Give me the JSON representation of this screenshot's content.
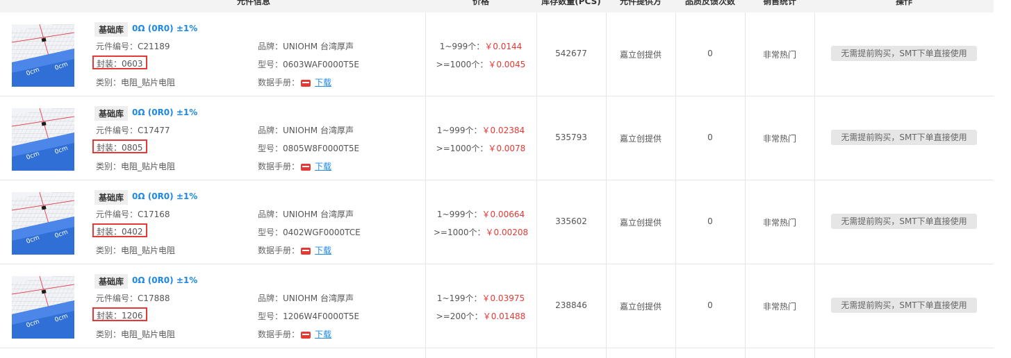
{
  "header": {
    "component_info": "元件信息",
    "price": "价格",
    "stock": "库存数量(PCS)",
    "provider": "元件提供方",
    "feedback": "品质反馈次数",
    "sales": "销售统计",
    "operation": "操作"
  },
  "rows": [
    {
      "tag": "基础库",
      "title": "0Ω (0R0) ±1%",
      "part_no_label": "元件编号：",
      "part_no": "C21189",
      "package_label": "封装：",
      "package": "0603",
      "category_label": "类别：",
      "category": "电阻_贴片电阻",
      "brand_label": "品牌：",
      "brand": "UNIOHM 台湾厚声",
      "model_label": "型号：",
      "model": "0603WAF0000T5E",
      "datasheet_label": "数据手册：",
      "download": "下载",
      "price_tiers": [
        {
          "qty": "1~999个：",
          "price": "￥0.0144"
        },
        {
          "qty": ">=1000个：",
          "price": "￥0.0045"
        }
      ],
      "stock": "542677",
      "provider": "嘉立创提供",
      "feedback": "0",
      "sales": "非常热门",
      "action": "无需提前购买，SMT下单直接使用"
    },
    {
      "tag": "基础库",
      "title": "0Ω (0R0) ±1%",
      "part_no_label": "元件编号：",
      "part_no": "C17477",
      "package_label": "封装：",
      "package": "0805",
      "category_label": "类别：",
      "category": "电阻_贴片电阻",
      "brand_label": "品牌：",
      "brand": "UNIOHM 台湾厚声",
      "model_label": "型号：",
      "model": "0805W8F0000T5E",
      "datasheet_label": "数据手册：",
      "download": "下载",
      "price_tiers": [
        {
          "qty": "1~999个：",
          "price": "￥0.02384"
        },
        {
          "qty": ">=1000个：",
          "price": "￥0.0078"
        }
      ],
      "stock": "535793",
      "provider": "嘉立创提供",
      "feedback": "0",
      "sales": "非常热门",
      "action": "无需提前购买，SMT下单直接使用"
    },
    {
      "tag": "基础库",
      "title": "0Ω (0R0) ±1%",
      "part_no_label": "元件编号：",
      "part_no": "C17168",
      "package_label": "封装：",
      "package": "0402",
      "category_label": "类别：",
      "category": "电阻_贴片电阻",
      "brand_label": "品牌：",
      "brand": "UNIOHM 台湾厚声",
      "model_label": "型号：",
      "model": "0402WGF0000TCE",
      "datasheet_label": "数据手册：",
      "download": "下载",
      "price_tiers": [
        {
          "qty": "1~999个：",
          "price": "￥0.00664"
        },
        {
          "qty": ">=1000个：",
          "price": "￥0.00208"
        }
      ],
      "stock": "335602",
      "provider": "嘉立创提供",
      "feedback": "0",
      "sales": "非常热门",
      "action": "无需提前购买，SMT下单直接使用"
    },
    {
      "tag": "基础库",
      "title": "0Ω (0R0) ±1%",
      "part_no_label": "元件编号：",
      "part_no": "C17888",
      "package_label": "封装：",
      "package": "1206",
      "category_label": "类别：",
      "category": "电阻_贴片电阻",
      "brand_label": "品牌：",
      "brand": "UNIOHM 台湾厚声",
      "model_label": "型号：",
      "model": "1206W4F0000T5E",
      "datasheet_label": "数据手册：",
      "download": "下载",
      "price_tiers": [
        {
          "qty": "1~199个：",
          "price": "￥0.03975"
        },
        {
          "qty": ">=200个：",
          "price": "￥0.01488"
        }
      ],
      "stock": "238846",
      "provider": "嘉立创提供",
      "feedback": "0",
      "sales": "非常热门",
      "action": "无需提前购买，SMT下单直接使用"
    }
  ],
  "colors": {
    "accent_blue": "#1e88e5",
    "price_red": "#e53935",
    "highlight_red": "#e53935",
    "thumb_blue": "#2f6fd6"
  },
  "icons": {
    "thumbnail": "resistor-chip-on-ruler-image",
    "datasheet": "pdf-icon"
  }
}
